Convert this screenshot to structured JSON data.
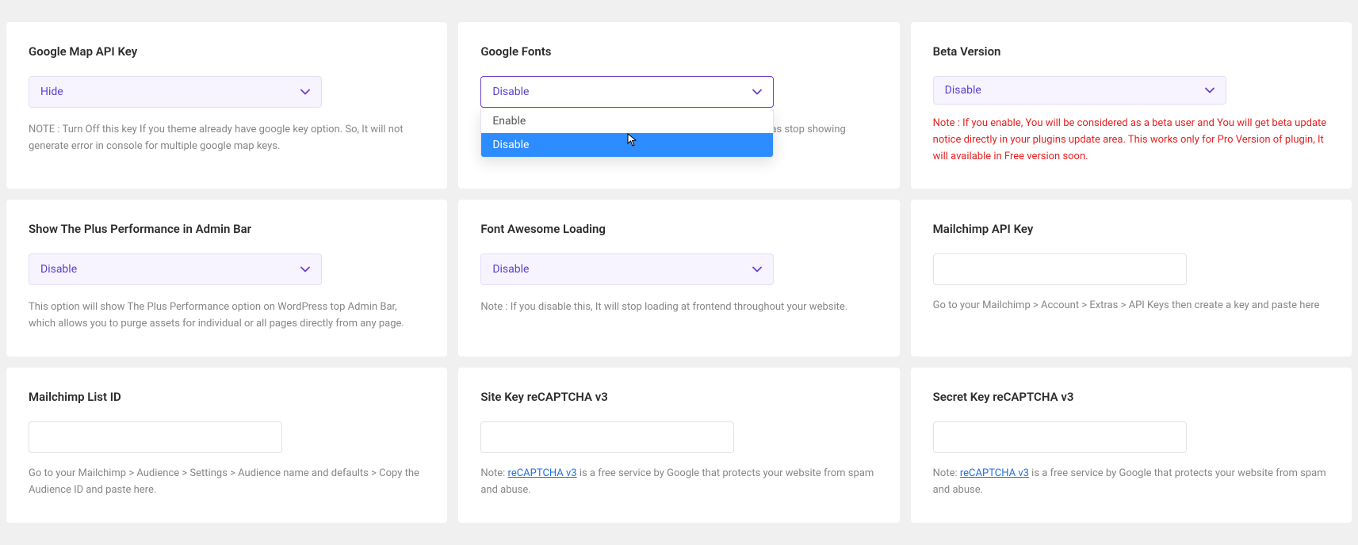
{
  "cards": {
    "google_map": {
      "title": "Google Map API Key",
      "selected": "Hide",
      "note": "NOTE : Turn Off this key If you theme already have google key option. So, It will not generate error in console for multiple google map keys."
    },
    "google_fonts": {
      "title": "Google Fonts",
      "selected": "Disable",
      "options": [
        "Enable",
        "Disable"
      ],
      "note_pre": "",
      "note_post": "as stop showing values in Font Family Selection."
    },
    "beta_version": {
      "title": "Beta Version",
      "selected": "Disable",
      "note": "Note : If you enable, You will be considered as a beta user and You will get beta update notice directly in your plugins update area. This works only for Pro Version of plugin, It will available in Free version soon."
    },
    "plus_perf": {
      "title": "Show The Plus Performance in Admin Bar",
      "selected": "Disable",
      "note": "This option will show The Plus Performance option on WordPress top Admin Bar, which allows you to purge assets for individual or all pages directly from any page."
    },
    "font_awesome": {
      "title": "Font Awesome Loading",
      "selected": "Disable",
      "note": "Note : If you disable this, It will stop loading at frontend throughout your website."
    },
    "mailchimp_api": {
      "title": "Mailchimp API Key",
      "note": "Go to your Mailchimp > Account > Extras > API Keys then create a key and paste here"
    },
    "mailchimp_list": {
      "title": "Mailchimp List ID",
      "note": "Go to your Mailchimp > Audience > Settings > Audience name and defaults > Copy the Audience ID and paste here."
    },
    "site_key": {
      "title": "Site Key reCAPTCHA v3",
      "note_prefix": "Note: ",
      "link_text": "reCAPTCHA v3",
      "note_suffix": " is a free service by Google that protects your website from spam and abuse."
    },
    "secret_key": {
      "title": "Secret Key reCAPTCHA v3",
      "note_prefix": "Note: ",
      "link_text": "reCAPTCHA v3",
      "note_suffix": " is a free service by Google that protects your website from spam and abuse."
    }
  }
}
